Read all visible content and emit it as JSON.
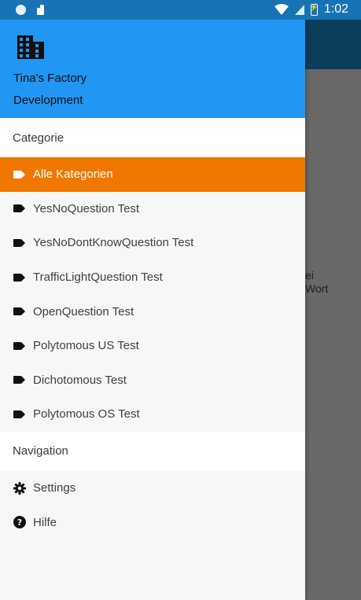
{
  "status_bar": {
    "time": "1:02"
  },
  "background": {
    "partial_text_line1": "ei",
    "partial_text_line2": "Wort"
  },
  "drawer": {
    "header": {
      "name": "Tina's Factory",
      "subtitle": "Development",
      "icon": "building-icon"
    },
    "categories_title": "Categorie",
    "categories": [
      {
        "label": "Alle Kategorien",
        "icon": "tag-icon",
        "selected": true
      },
      {
        "label": "YesNoQuestion Test",
        "icon": "tag-icon"
      },
      {
        "label": "YesNoDontKnowQuestion Test",
        "icon": "tag-icon"
      },
      {
        "label": "TrafficLightQuestion Test",
        "icon": "tag-icon"
      },
      {
        "label": "OpenQuestion Test",
        "icon": "tag-icon"
      },
      {
        "label": "Polytomous US Test",
        "icon": "tag-icon"
      },
      {
        "label": "Dichotomous Test",
        "icon": "tag-icon"
      },
      {
        "label": "Polytomous OS Test",
        "icon": "tag-icon"
      }
    ],
    "navigation_title": "Navigation",
    "navigation": [
      {
        "label": "Settings",
        "icon": "gear-icon"
      },
      {
        "label": "Hilfe",
        "icon": "help-circle-icon"
      }
    ]
  },
  "colors": {
    "header": "#2196f3",
    "status_bar": "#1873b5",
    "selected_item": "#f07800",
    "scrim": "#686868"
  }
}
